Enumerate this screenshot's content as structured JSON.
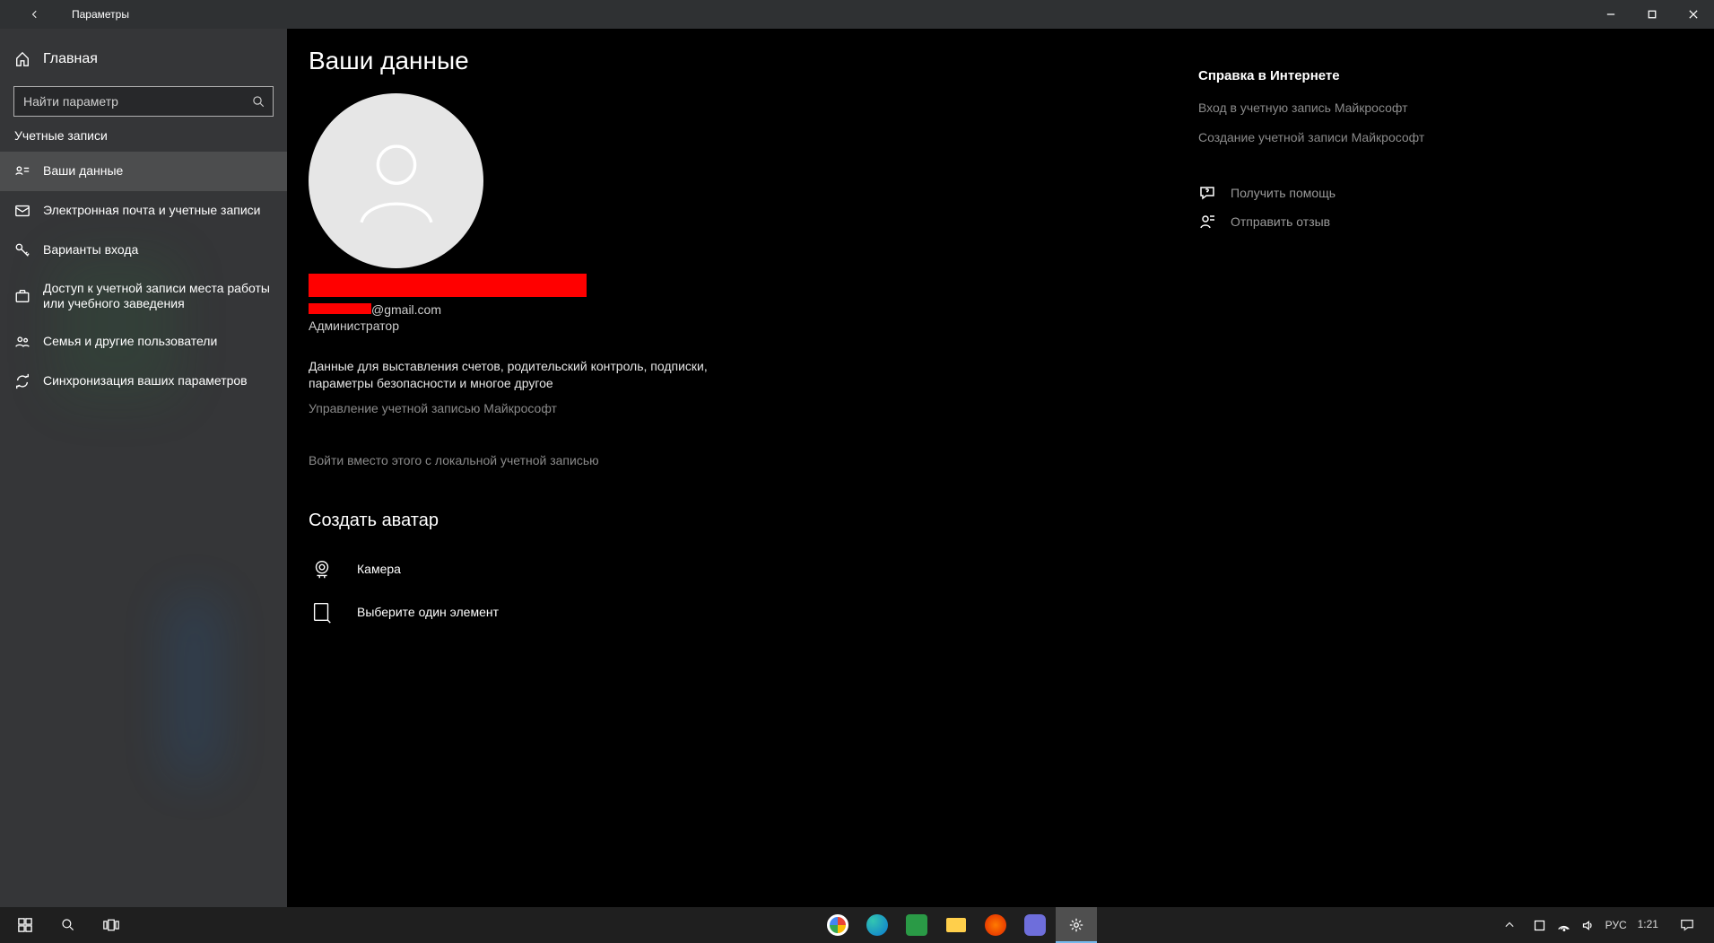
{
  "app_title": "Параметры",
  "home_label": "Главная",
  "search_placeholder": "Найти параметр",
  "sidebar_section": "Учетные записи",
  "nav": {
    "your_info": "Ваши данные",
    "email": "Электронная почта и учетные записи",
    "signin": "Варианты входа",
    "work": "Доступ к учетной записи места работы или учебного заведения",
    "family": "Семья и другие пользователи",
    "sync": "Синхронизация ваших параметров"
  },
  "page": {
    "title": "Ваши данные",
    "email_suffix": "@gmail.com",
    "role": "Администратор",
    "desc": "Данные для выставления счетов, родительский контроль, подписки, параметры безопасности и многое другое",
    "manage_link": "Управление учетной записью Майкрософт",
    "local_link": "Войти вместо этого с локальной учетной записью",
    "create_avatar": "Создать аватар",
    "camera_label": "Камера",
    "browse_label": "Выберите один элемент"
  },
  "side": {
    "help_heading": "Справка в Интернете",
    "signin_ms": "Вход в учетную запись Майкрософт",
    "create_ms": "Создание учетной записи Майкрософт",
    "get_help": "Получить помощь",
    "feedback": "Отправить отзыв"
  },
  "taskbar": {
    "lang": "РУС",
    "time": "1:21"
  }
}
